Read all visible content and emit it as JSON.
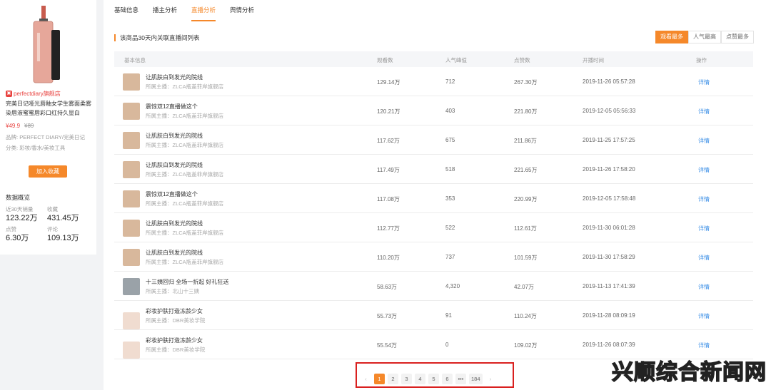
{
  "product": {
    "shop": "perfectdiary旗舰店",
    "name": "完美日记哑光唇釉女学生雾面柔雾染唇液蜜蜜唇彩口红持久显白",
    "price": "¥49.9",
    "orig_price": "¥89",
    "brand_label": "品牌:",
    "brand": "PERFECT DIARY/完美日记",
    "category_label": "分类:",
    "category": "彩妆/香水/美妆工具",
    "fav_button": "加入收藏"
  },
  "overview": {
    "title": "数据概览",
    "items": [
      {
        "label": "近30天销量",
        "value": "123.22万"
      },
      {
        "label": "收藏",
        "value": "431.45万"
      },
      {
        "label": "点赞",
        "value": "6.30万"
      },
      {
        "label": "评论",
        "value": "109.13万"
      }
    ]
  },
  "tabs": [
    "基础信息",
    "播主分析",
    "直播分析",
    "舆情分析"
  ],
  "active_tab": 2,
  "section_title": "该商品30天内关联直播间列表",
  "sort_options": [
    "观看最多",
    "人气最高",
    "点赞最多"
  ],
  "table": {
    "headers": [
      "基本信息",
      "观看数",
      "人气峰值",
      "点赞数",
      "开播时间",
      "操作"
    ],
    "host_prefix": "所属主播：",
    "rows": [
      {
        "title": "让肌肤白到发光的院线",
        "host": "ZLCA瓶盖菲岸旗舰店",
        "views": "129.14万",
        "peak": "712",
        "likes": "267.30万",
        "time": "2019-11-26 05:57:28",
        "action": "详情",
        "thumb": "a"
      },
      {
        "title": "震惊双12直播做这个",
        "host": "ZLCA瓶盖菲岸旗舰店",
        "views": "120.21万",
        "peak": "403",
        "likes": "221.80万",
        "time": "2019-12-05 05:56:33",
        "action": "详情",
        "thumb": "a"
      },
      {
        "title": "让肌肤白到发光的院线",
        "host": "ZLCA瓶盖菲岸旗舰店",
        "views": "117.62万",
        "peak": "675",
        "likes": "211.86万",
        "time": "2019-11-25 17:57:25",
        "action": "详情",
        "thumb": "a"
      },
      {
        "title": "让肌肤白到发光的院线",
        "host": "ZLCA瓶盖菲岸旗舰店",
        "views": "117.49万",
        "peak": "518",
        "likes": "221.65万",
        "time": "2019-11-26 17:58:20",
        "action": "详情",
        "thumb": "a"
      },
      {
        "title": "震惊双12直播做这个",
        "host": "ZLCA瓶盖菲岸旗舰店",
        "views": "117.08万",
        "peak": "353",
        "likes": "220.99万",
        "time": "2019-12-05 17:58:48",
        "action": "详情",
        "thumb": "a"
      },
      {
        "title": "让肌肤白到发光的院线",
        "host": "ZLCA瓶盖菲岸旗舰店",
        "views": "112.77万",
        "peak": "522",
        "likes": "112.61万",
        "time": "2019-11-30 06:01:28",
        "action": "详情",
        "thumb": "a"
      },
      {
        "title": "让肌肤白到发光的院线",
        "host": "ZLCA瓶盖菲岸旗舰店",
        "views": "110.20万",
        "peak": "737",
        "likes": "101.59万",
        "time": "2019-11-30 17:58:29",
        "action": "详情",
        "thumb": "a"
      },
      {
        "title": "十三姨回归 全场一折起 好礼狂送",
        "host": "北山十三姨",
        "views": "58.63万",
        "peak": "4,320",
        "likes": "42.07万",
        "time": "2019-11-13 17:41:39",
        "action": "详情",
        "thumb": "b"
      },
      {
        "title": "彩妆护肤打造冻龄少女",
        "host": "DBR美妆学院",
        "views": "55.73万",
        "peak": "91",
        "likes": "110.24万",
        "time": "2019-11-28 08:09:19",
        "action": "详情",
        "thumb": "c"
      },
      {
        "title": "彩妆护肤打造冻龄少女",
        "host": "DBR美妆学院",
        "views": "55.54万",
        "peak": "0",
        "likes": "109.02万",
        "time": "2019-11-26 08:07:39",
        "action": "详情",
        "thumb": "c"
      }
    ]
  },
  "pagination": {
    "prev": "‹",
    "pages": [
      "1",
      "2",
      "3",
      "4",
      "5",
      "6",
      "•••",
      "184"
    ],
    "active": "1",
    "next": "›"
  },
  "watermark": "兴顺综合新闻网",
  "colors": {
    "accent": "#f5882a",
    "link": "#3a8ee6",
    "highlight_box": "#d9201f"
  }
}
